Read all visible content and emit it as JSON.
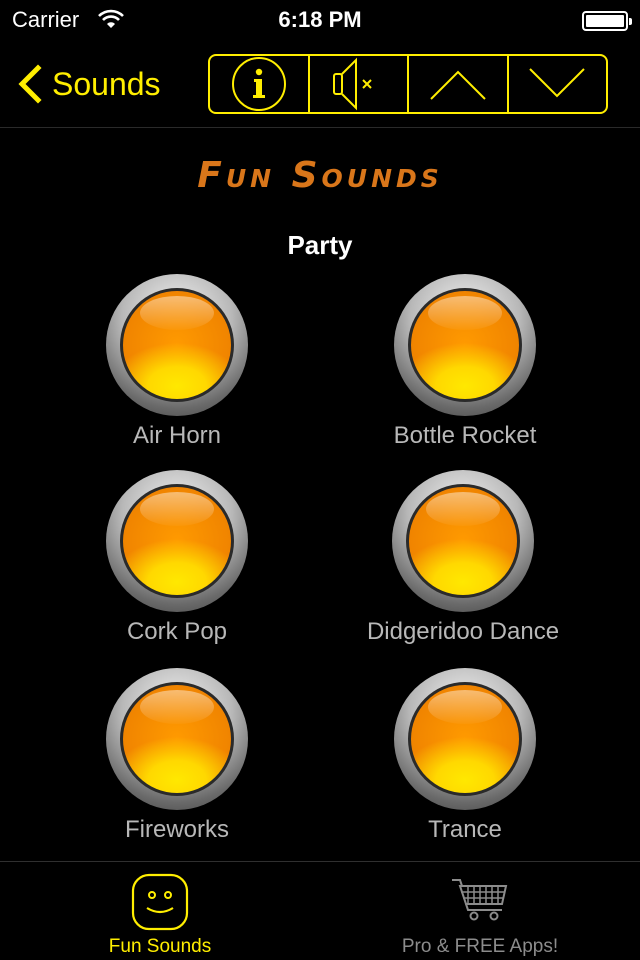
{
  "status_bar": {
    "carrier": "Carrier",
    "time": "6:18 PM",
    "icons": [
      "wifi-icon",
      "battery-icon"
    ]
  },
  "nav": {
    "back_label": "Sounds",
    "back_icon": "chevron-left-icon",
    "accent_color": "#ffee00",
    "toolbar": [
      {
        "name": "info",
        "icon": "info-icon"
      },
      {
        "name": "mute",
        "icon": "speaker-mute-icon"
      },
      {
        "name": "previous",
        "icon": "chevron-up-icon"
      },
      {
        "name": "next",
        "icon": "chevron-down-icon"
      }
    ]
  },
  "main": {
    "banner_title": "Fun Sounds",
    "banner_color": "#d9761a",
    "section_title": "Party",
    "sounds": [
      {
        "label": "Air Horn"
      },
      {
        "label": "Bottle Rocket"
      },
      {
        "label": "Cork Pop"
      },
      {
        "label": "Didgeridoo Dance"
      },
      {
        "label": "Fireworks"
      },
      {
        "label": "Trance"
      }
    ]
  },
  "tab_bar": {
    "tabs": [
      {
        "label": "Fun Sounds",
        "icon": "smiley-face-icon",
        "active": true
      },
      {
        "label": "Pro & FREE Apps!",
        "icon": "shopping-cart-icon",
        "active": false
      }
    ]
  }
}
